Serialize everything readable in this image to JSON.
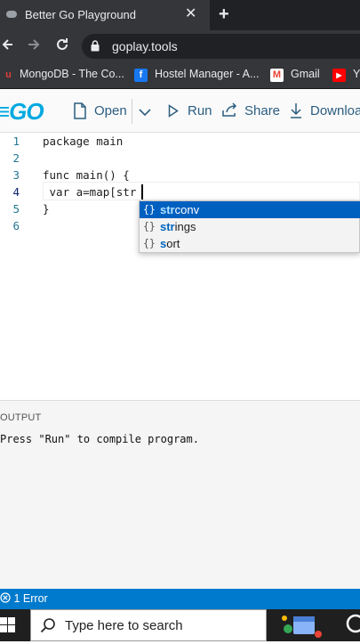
{
  "browser": {
    "tab_title": "Better Go Playground",
    "tab_close": "✕",
    "new_tab": "+",
    "url": "goplay.tools",
    "bookmarks": [
      {
        "label": "MongoDB - The Co..."
      },
      {
        "label": "Hostel Manager - A..."
      },
      {
        "label": "Gmail"
      },
      {
        "label": "Y"
      }
    ]
  },
  "appbar": {
    "logo": "≡GO",
    "open_label": "Open",
    "run_label": "Run",
    "share_label": "Share",
    "download_label": "Download"
  },
  "editor": {
    "lines": [
      {
        "n": "1",
        "text": "package main"
      },
      {
        "n": "2",
        "text": ""
      },
      {
        "n": "3",
        "text": "func main() {"
      },
      {
        "n": "4",
        "text": " var a=map[str"
      },
      {
        "n": "5",
        "text": "}"
      },
      {
        "n": "6",
        "text": ""
      }
    ],
    "suggestions": [
      {
        "icon": "{}",
        "match": "str",
        "rest": "conv",
        "selected": true
      },
      {
        "icon": "{}",
        "match": "str",
        "rest": "ings",
        "selected": false
      },
      {
        "icon": "{}",
        "match": "s",
        "rest": "ort",
        "selected": false
      }
    ]
  },
  "output": {
    "heading": "OUTPUT",
    "text": "Press \"Run\" to compile program."
  },
  "status": {
    "errors": "1 Error"
  },
  "taskbar": {
    "search_placeholder": "Type here to search"
  },
  "colors": {
    "accent": "#007acc",
    "go_blue": "#00a9e0",
    "selection": "#0060c0"
  }
}
